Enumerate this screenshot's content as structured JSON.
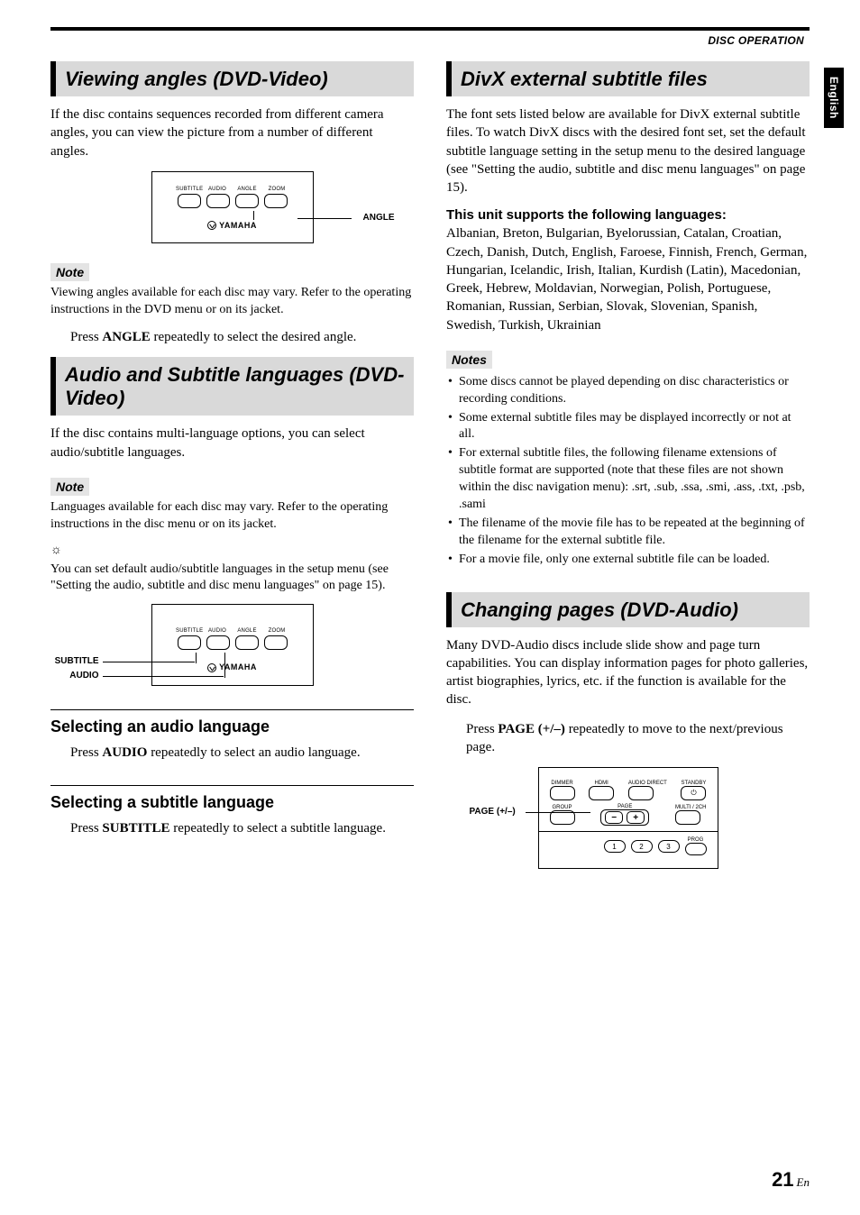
{
  "header": {
    "stripe": "DISC OPERATION",
    "side_tab": "English"
  },
  "left": {
    "viewing": {
      "title": "Viewing angles (DVD-Video)",
      "intro": "If the disc contains sequences recorded from different camera angles, you can view the picture from a number of different angles.",
      "note_label": "Note",
      "note_text": "Viewing angles available for each disc may vary. Refer to the operating instructions in the DVD menu or on its jacket.",
      "instr_pre": "Press ",
      "instr_kw": "ANGLE",
      "instr_post": " repeatedly to select the desired angle.",
      "callout": "ANGLE",
      "btn_labels": [
        "SUBTITLE",
        "AUDIO",
        "ANGLE",
        "ZOOM"
      ],
      "brand": "YAMAHA"
    },
    "audio_sub": {
      "title": "Audio and Subtitle languages (DVD-Video)",
      "intro": "If the disc contains multi-language options, you can select audio/subtitle languages.",
      "note_label": "Note",
      "note_text": "Languages available for each disc may vary. Refer to the operating instructions in the disc menu or on its jacket.",
      "tip_icon": "☼",
      "tip_text": "You can set default audio/subtitle languages in the setup menu (see \"Setting the audio, subtitle and disc menu languages\" on page 15).",
      "callout_subtitle": "SUBTITLE",
      "callout_audio": "AUDIO",
      "btn_labels": [
        "SUBTITLE",
        "AUDIO",
        "ANGLE",
        "ZOOM"
      ],
      "brand": "YAMAHA",
      "sel_audio_h": "Selecting an audio language",
      "sel_audio_pre": "Press ",
      "sel_audio_kw": "AUDIO",
      "sel_audio_post": " repeatedly to select an audio language.",
      "sel_sub_h": "Selecting a subtitle language",
      "sel_sub_pre": "Press ",
      "sel_sub_kw": "SUBTITLE",
      "sel_sub_post": " repeatedly to select a subtitle language."
    }
  },
  "right": {
    "divx": {
      "title": "DivX external subtitle files",
      "intro": "The font sets listed below are available for DivX external subtitle files. To watch DivX discs with the desired font set, set the default subtitle language setting in the setup menu to the desired language (see \"Setting the audio, subtitle and disc menu languages\" on page 15).",
      "lang_hdr": "This unit supports the following languages:",
      "lang_list": "Albanian, Breton, Bulgarian, Byelorussian, Catalan, Croatian, Czech, Danish, Dutch, English, Faroese, Finnish, French, German, Hungarian, Icelandic, Irish, Italian, Kurdish (Latin), Macedonian, Greek, Hebrew, Moldavian, Norwegian, Polish, Portuguese, Romanian, Russian, Serbian, Slovak, Slovenian, Spanish, Swedish, Turkish, Ukrainian",
      "notes_label": "Notes",
      "notes": [
        "Some discs cannot be played depending on disc characteristics or recording conditions.",
        "Some external subtitle files may be displayed incorrectly or not at all.",
        "For external subtitle files, the following filename extensions of subtitle format are supported (note that these files are not shown within the disc navigation menu): .srt, .sub, .ssa, .smi, .ass, .txt, .psb, .sami",
        "The filename of the movie file has to be repeated at the beginning of the filename for the external subtitle file.",
        "For a movie file, only one external subtitle file can be loaded."
      ]
    },
    "pages": {
      "title": "Changing pages (DVD-Audio)",
      "intro": "Many DVD-Audio discs include slide show and page turn capabilities. You can display information pages for photo galleries, artist biographies, lyrics, etc. if the function is available for the disc.",
      "instr_pre": "Press ",
      "instr_kw": "PAGE (+/–)",
      "instr_post": " repeatedly to move to the next/previous page.",
      "callout": "PAGE (+/–)",
      "labels": {
        "dimmer": "DIMMER",
        "hdmi": "HDMI",
        "audio_direct": "AUDIO DIRECT",
        "standby": "STANDBY",
        "group": "GROUP",
        "page": "PAGE",
        "multi": "MULTI / 2CH",
        "prog": "PROG"
      },
      "nums": [
        "1",
        "2",
        "3"
      ]
    }
  },
  "footer": {
    "page": "21",
    "lang": "En"
  }
}
